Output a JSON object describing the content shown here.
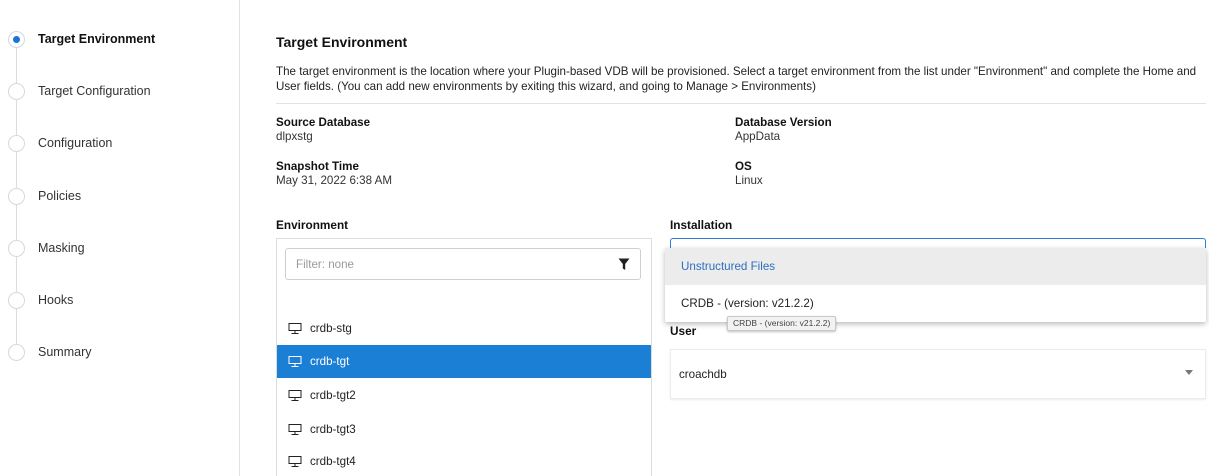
{
  "sidebar": {
    "steps": [
      {
        "label": "Target Environment",
        "active": true
      },
      {
        "label": "Target Configuration",
        "active": false
      },
      {
        "label": "Configuration",
        "active": false
      },
      {
        "label": "Policies",
        "active": false
      },
      {
        "label": "Masking",
        "active": false
      },
      {
        "label": "Hooks",
        "active": false
      },
      {
        "label": "Summary",
        "active": false
      }
    ]
  },
  "main": {
    "title": "Target Environment",
    "description": "The target environment is the location where your Plugin-based VDB will be provisioned. Select a target environment from the list under \"Environment\" and complete the Home and User fields. (You can add new environments by exiting this wizard, and going to Manage > Environments)",
    "info": {
      "source_database": {
        "label": "Source Database",
        "value": "dlpxstg"
      },
      "database_version": {
        "label": "Database Version",
        "value": "AppData"
      },
      "snapshot_time": {
        "label": "Snapshot Time",
        "value": "May 31, 2022 6:38 AM"
      },
      "os": {
        "label": "OS",
        "value": "Linux"
      }
    },
    "environment": {
      "label": "Environment",
      "filter_placeholder": "Filter: none",
      "items": [
        {
          "name": "crdb-stg",
          "selected": false
        },
        {
          "name": "crdb-tgt",
          "selected": true
        },
        {
          "name": "crdb-tgt2",
          "selected": false
        },
        {
          "name": "crdb-tgt3",
          "selected": false
        },
        {
          "name": "crdb-tgt4",
          "selected": false
        }
      ]
    },
    "installation": {
      "label": "Installation",
      "options": [
        "Unstructured Files",
        "CRDB - (version: v21.2.2)"
      ],
      "highlighted": "Unstructured Files",
      "tooltip": "CRDB - (version: v21.2.2)"
    },
    "user": {
      "label": "User",
      "value": "croachdb"
    }
  },
  "colors": {
    "accent": "#1b7fd6",
    "highlight_text": "#2b6fbf"
  },
  "icons": {
    "filter": "funnel-icon",
    "environment": "monitor-icon",
    "dropdown": "caret-down-icon"
  }
}
